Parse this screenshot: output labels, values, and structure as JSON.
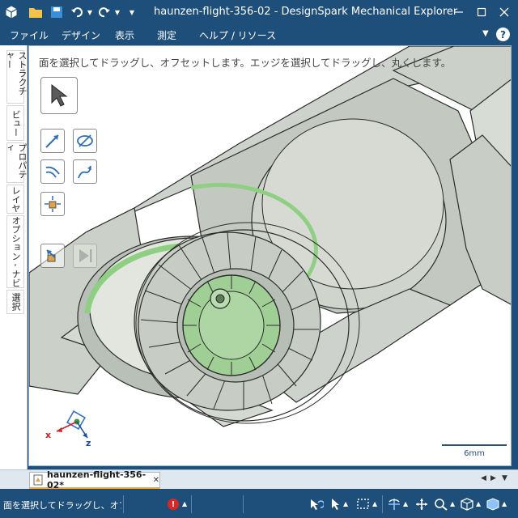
{
  "window": {
    "title": "haunzen-flight-356-02 - DesignSpark Mechanical Explorer"
  },
  "quick_access": {
    "app_icon": "app-cube-icon",
    "open_icon": "folder-icon",
    "save_icon": "save-icon",
    "undo_icon": "undo-icon",
    "redo_icon": "redo-icon"
  },
  "menu": {
    "items": [
      "ファイル",
      "デザイン",
      "表示",
      "測定",
      "ヘルプ / リソース"
    ],
    "help_label": "?"
  },
  "side_tabs": [
    "ストラクチャー",
    "ビュー",
    "プロパティ",
    "レイヤ",
    "オプション - ナビ",
    "選択"
  ],
  "viewport": {
    "hint": "面を選択してドラッグし、オフセットします。エッジを選択してドラッグし、丸くします。",
    "scale_label": "6mm",
    "triad": {
      "x": "x",
      "z": "z"
    }
  },
  "doc_tab": {
    "label": "haunzen-flight-356-02*",
    "close": "✕"
  },
  "doc_nav": {
    "prev": "◀",
    "next": "▶",
    "menu": "▼"
  },
  "status": {
    "text": "面を選択してドラッグし、オフセットします。",
    "error_icon": "!"
  },
  "colors": {
    "chrome": "#1e4f7a",
    "model": "#d4d9d2",
    "selected_face": "#9fcf95",
    "accent_tab": "#f2a93b"
  }
}
